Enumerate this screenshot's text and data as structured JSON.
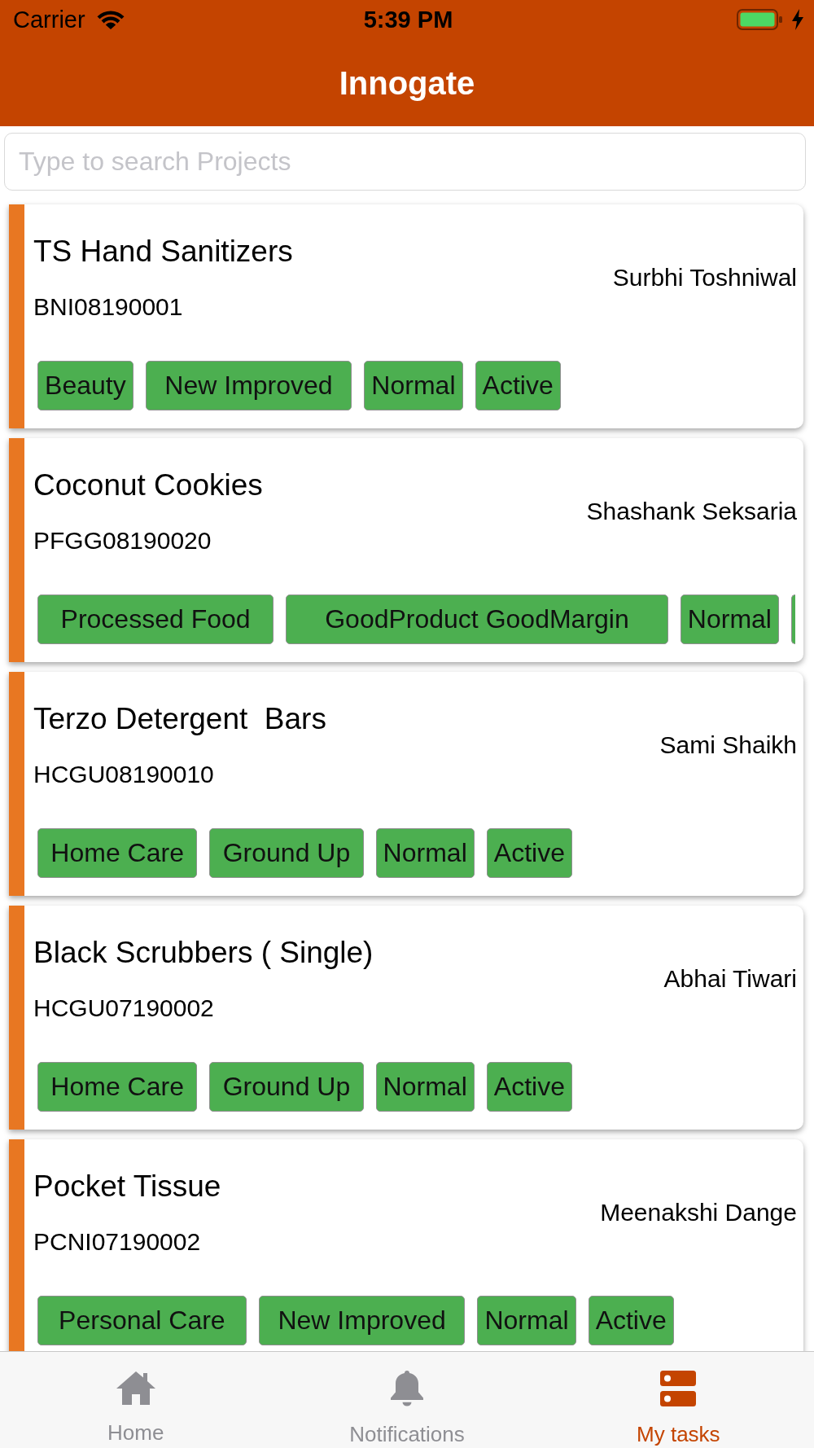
{
  "status_bar": {
    "carrier": "Carrier",
    "time": "5:39 PM"
  },
  "header": {
    "title": "Innogate"
  },
  "search": {
    "placeholder": "Type to search Projects"
  },
  "projects": [
    {
      "name": "TS Hand Sanitizers",
      "code": "BNI08190001",
      "owner": "Surbhi Toshniwal",
      "tags": [
        "Beauty",
        "New Improved",
        "Normal",
        "Active"
      ],
      "tags_overflow": false
    },
    {
      "name": "Coconut Cookies",
      "code": "PFGG08190020",
      "owner": "Shashank Seksaria",
      "tags": [
        "Processed Food",
        "GoodProduct GoodMargin",
        "Normal"
      ],
      "tags_overflow": true
    },
    {
      "name": "Terzo Detergent  Bars",
      "code": "HCGU08190010",
      "owner": "Sami Shaikh",
      "tags": [
        "Home Care",
        "Ground Up",
        "Normal",
        "Active"
      ],
      "tags_overflow": false
    },
    {
      "name": "Black Scrubbers ( Single)",
      "code": "HCGU07190002",
      "owner": "Abhai Tiwari",
      "tags": [
        "Home Care",
        "Ground Up",
        "Normal",
        "Active"
      ],
      "tags_overflow": false
    },
    {
      "name": "Pocket Tissue",
      "code": "PCNI07190002",
      "owner": "Meenakshi Dange",
      "tags": [
        "Personal Care",
        "New Improved",
        "Normal",
        "Active"
      ],
      "tags_overflow": false
    }
  ],
  "tab_bar": [
    {
      "kind": "home",
      "label": "Home",
      "selected": false
    },
    {
      "kind": "bell",
      "label": "Notifications",
      "selected": false
    },
    {
      "kind": "tasks",
      "label": "My tasks",
      "selected": true
    }
  ]
}
